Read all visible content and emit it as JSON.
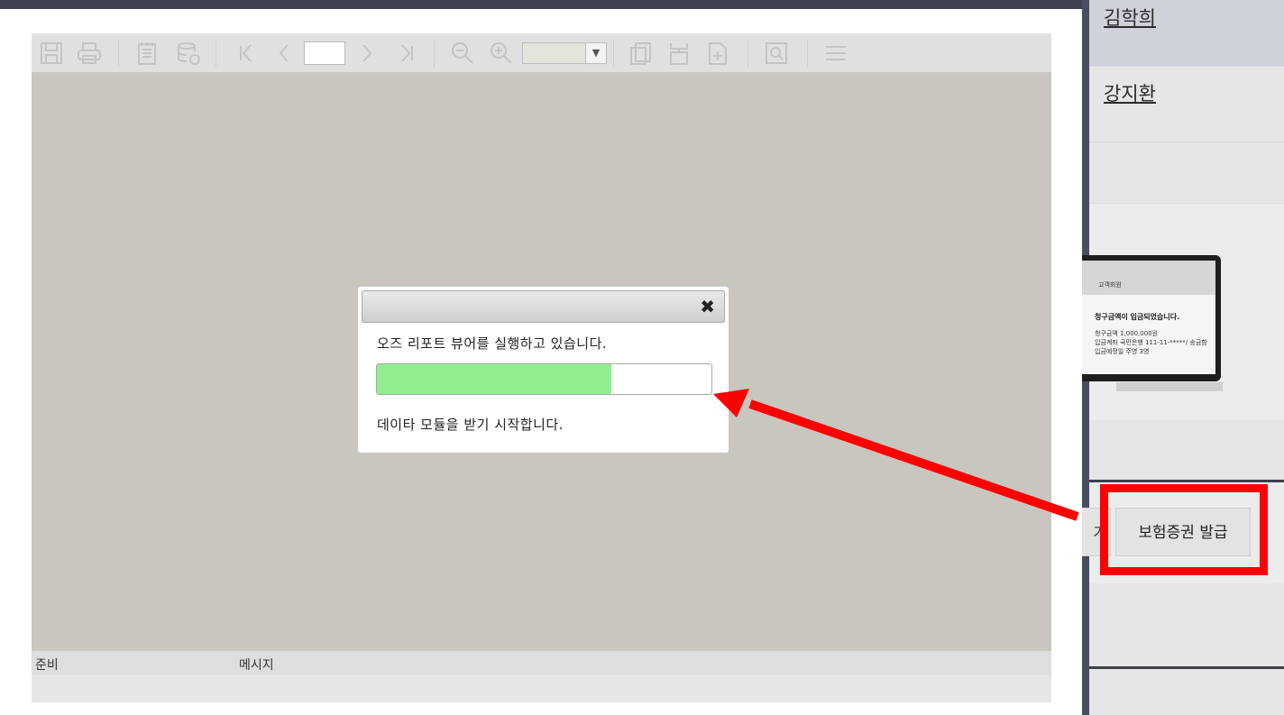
{
  "background_page": {
    "names": [
      "김학희",
      "강지환"
    ],
    "promo": {
      "header": "고객회원",
      "headline": "청구금액이 입금되었습니다.",
      "lines": [
        "청구금액   1,000,000원",
        "입금계좌   국민은행 111-11-*****/ 송금함",
        "입금예정일   주영 3영"
      ]
    },
    "prev_button_label": "기",
    "issue_button_label": "보험증권 발급"
  },
  "viewer": {
    "close_label": "",
    "toolbar_icons": [
      "save-icon",
      "print-icon",
      "export-icon",
      "db-save-icon",
      "first-page-icon",
      "prev-page-icon",
      "page-input",
      "next-page-icon",
      "last-page-icon",
      "zoom-out-icon",
      "zoom-in-icon",
      "zoom-select",
      "page-setup-icon",
      "page-layout-icon",
      "page-add-icon",
      "find-icon",
      "menu-icon"
    ],
    "page_input_value": "",
    "zoom_value": "",
    "status": {
      "ready": "준비",
      "message": "메시지"
    }
  },
  "dialog": {
    "close_label": "✖",
    "message": "오즈 리포트 뷰어를 실행하고 있습니다.",
    "progress": 0.7,
    "sub_message": "데이타 모듈을 받기 시작합니다."
  },
  "colors": {
    "progress_fill": "#90ee90",
    "annotation": "#ff0000",
    "viewer_canvas": "#c8c6bf"
  }
}
